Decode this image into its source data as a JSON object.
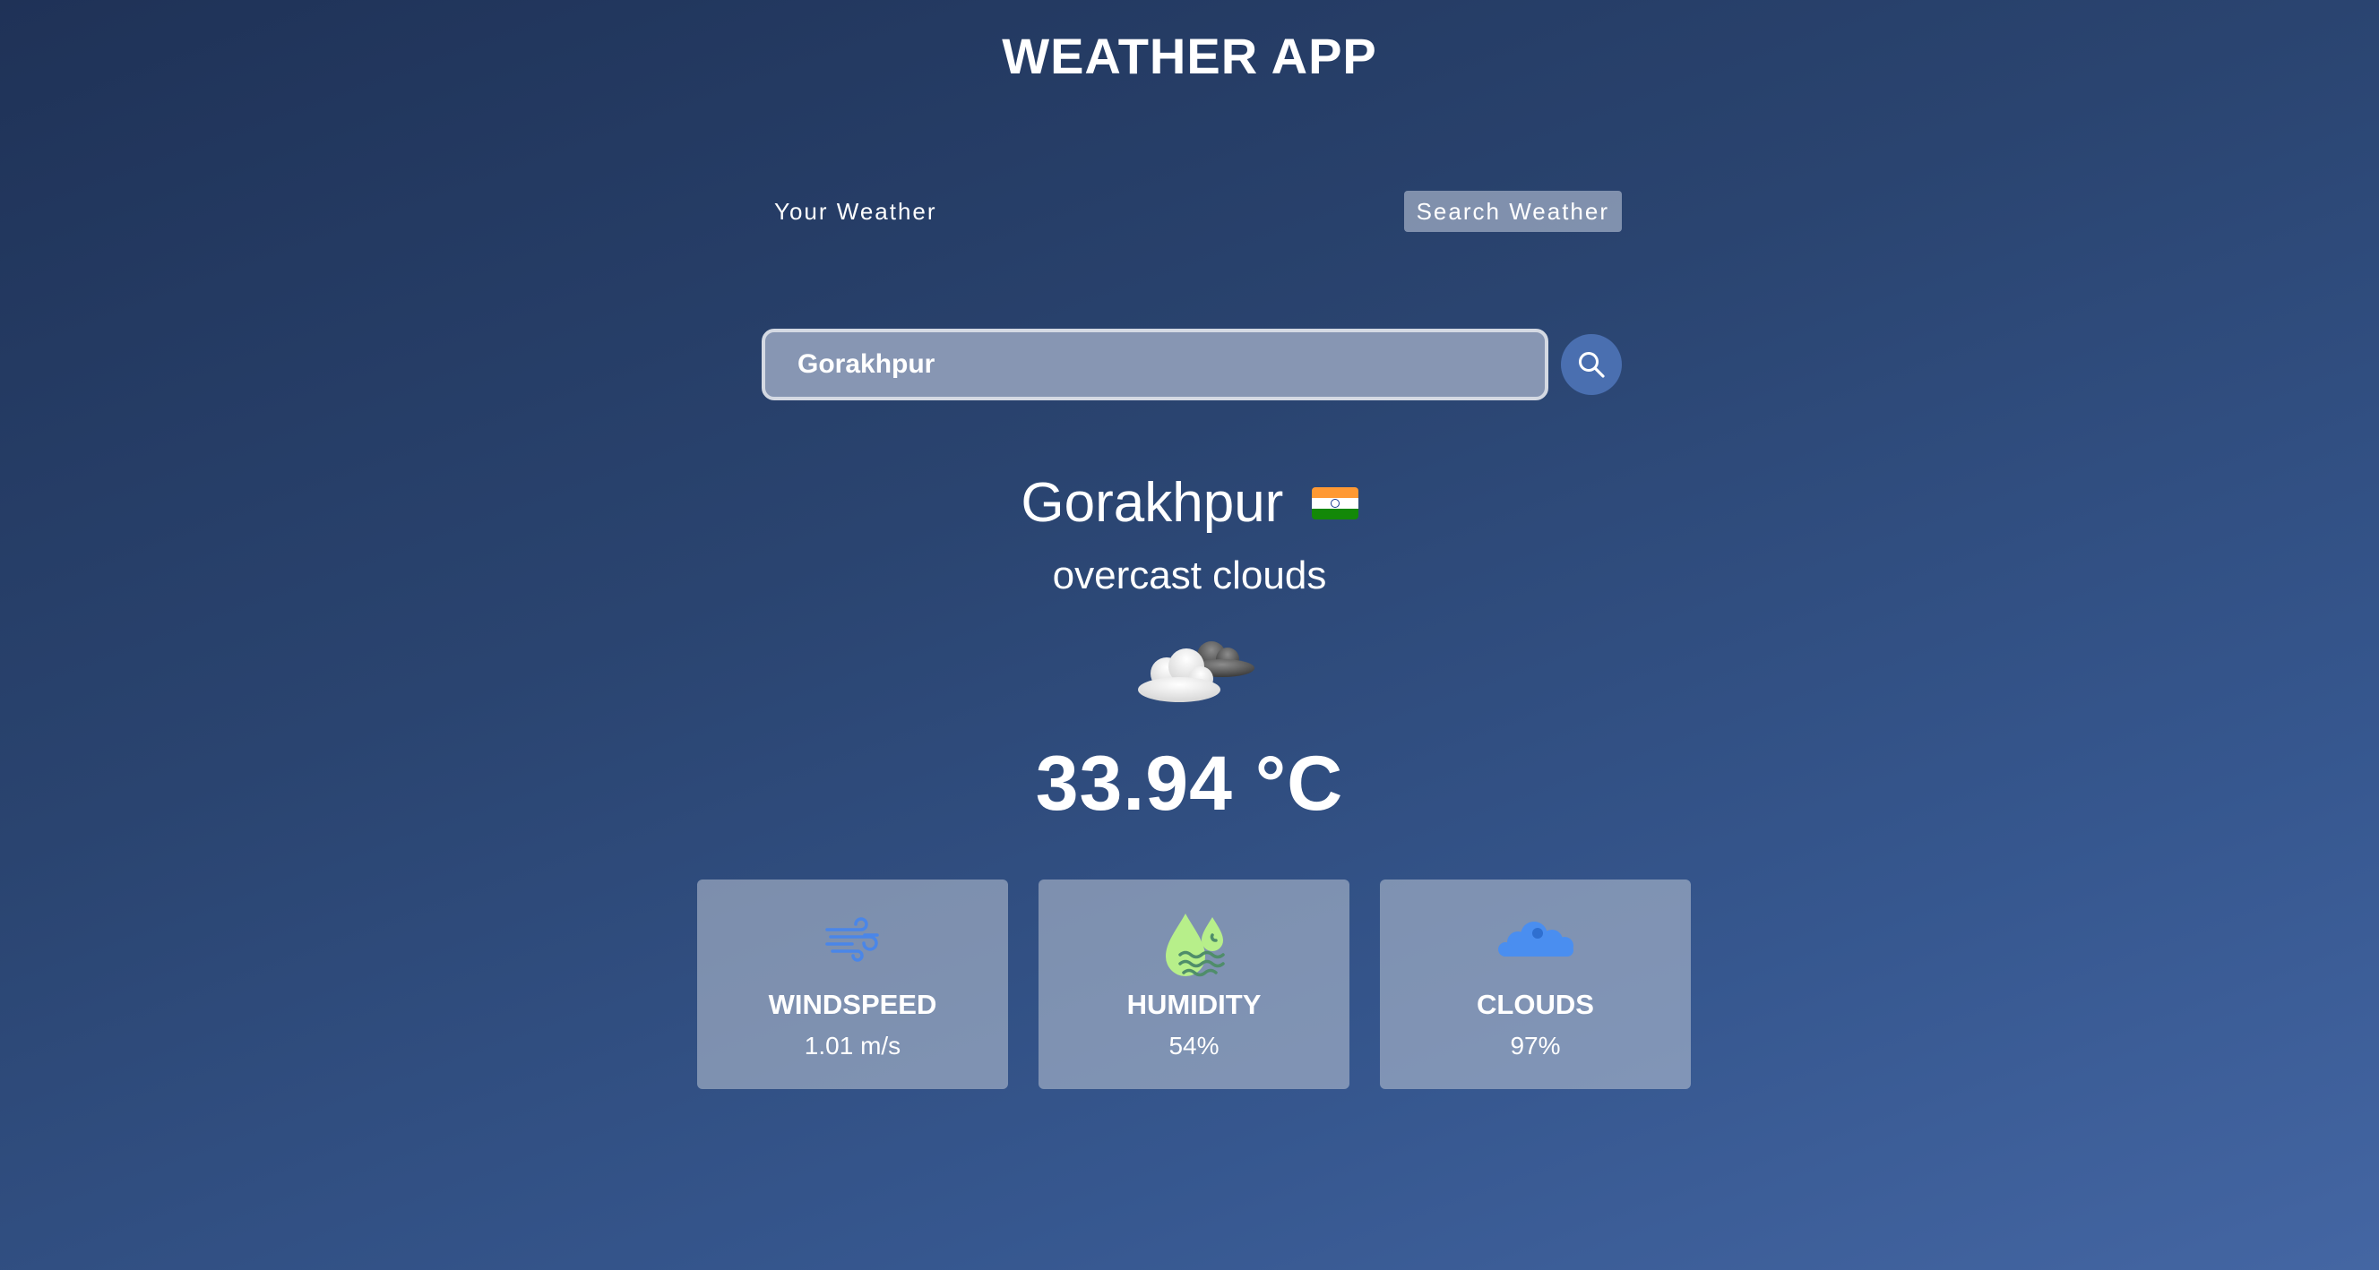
{
  "app": {
    "title": "WEATHER APP"
  },
  "tabs": [
    {
      "label": "Your Weather",
      "active": false
    },
    {
      "label": "Search Weather",
      "active": true
    }
  ],
  "search": {
    "value": "Gorakhpur",
    "placeholder": "Search for city...",
    "button_icon": "search-icon"
  },
  "weather": {
    "city": "Gorakhpur",
    "country_flag": "india-flag-icon",
    "description": "overcast clouds",
    "icon": "overcast-clouds-icon",
    "temperature": "33.94 °C"
  },
  "stats": [
    {
      "icon": "wind-icon",
      "label": "WINDSPEED",
      "value": "1.01 m/s"
    },
    {
      "icon": "humidity-icon",
      "label": "HUMIDITY",
      "value": "54%"
    },
    {
      "icon": "cloud-icon",
      "label": "CLOUDS",
      "value": "97%"
    }
  ],
  "colors": {
    "background_top": "#1f3257",
    "background_bottom": "#4466a3",
    "search_button": "#4a6fb0",
    "wind_icon": "#4a86e8",
    "humidity_icon": "#b7ef8a",
    "clouds_icon": "#4a8ef0"
  }
}
